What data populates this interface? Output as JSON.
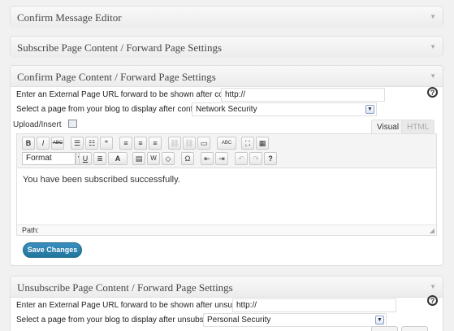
{
  "panels": {
    "confirm_message_editor": {
      "title": "Confirm Message Editor"
    },
    "subscribe_page": {
      "title": "Subscribe Page Content / Forward Page Settings"
    },
    "confirm_page": {
      "title": "Confirm Page Content / Forward Page Settings",
      "url_label": "Enter an External Page URL forward to be shown after confirming.",
      "url_value": "http://",
      "select_label": "Select a page from your blog to display after confirming.",
      "select_value": "Network Security",
      "help": "?"
    },
    "unsubscribe_page": {
      "title": "Unsubscribe Page Content / Forward Page Settings",
      "url_label": "Enter an External Page URL forward to be shown after unsubscribing.",
      "url_value": "http://",
      "select_label": "Select a page from your blog to display after unsubscribing.",
      "select_value": "Personal Security",
      "help": "?"
    }
  },
  "editor": {
    "upload_label": "Upload/Insert",
    "tabs": {
      "visual": "Visual",
      "html": "HTML"
    },
    "format_value": "Format",
    "content": "You have been subscribed successfully.",
    "path_label": "Path:"
  },
  "toolbar_glyphs": {
    "bold": "B",
    "italic": "I",
    "strike": "ABC",
    "bullets": "☰",
    "numbers": "☷",
    "quote": "“",
    "align_left": "≡",
    "align_center": "≡",
    "align_right": "≡",
    "link": "⛓",
    "unlink": "⛓",
    "more": "▭",
    "spell": "ABC",
    "fullscreen": "⛶",
    "kitchen": "▦",
    "underline": "U",
    "justify": "≣",
    "color": "A",
    "paste_text": "▤",
    "paste_word": "W",
    "clear": "◇",
    "special": "Ω",
    "outdent": "⇤",
    "indent": "⇥",
    "undo": "↶",
    "redo": "↷",
    "help": "?"
  },
  "buttons": {
    "save": "Save Changes"
  },
  "icons": {
    "toggle": "▼",
    "select_arrow": "▼",
    "resize": "◢"
  },
  "colors": {
    "accent": "#21759b",
    "panel_border": "#dfdfdf",
    "background": "#f1f1f1"
  }
}
